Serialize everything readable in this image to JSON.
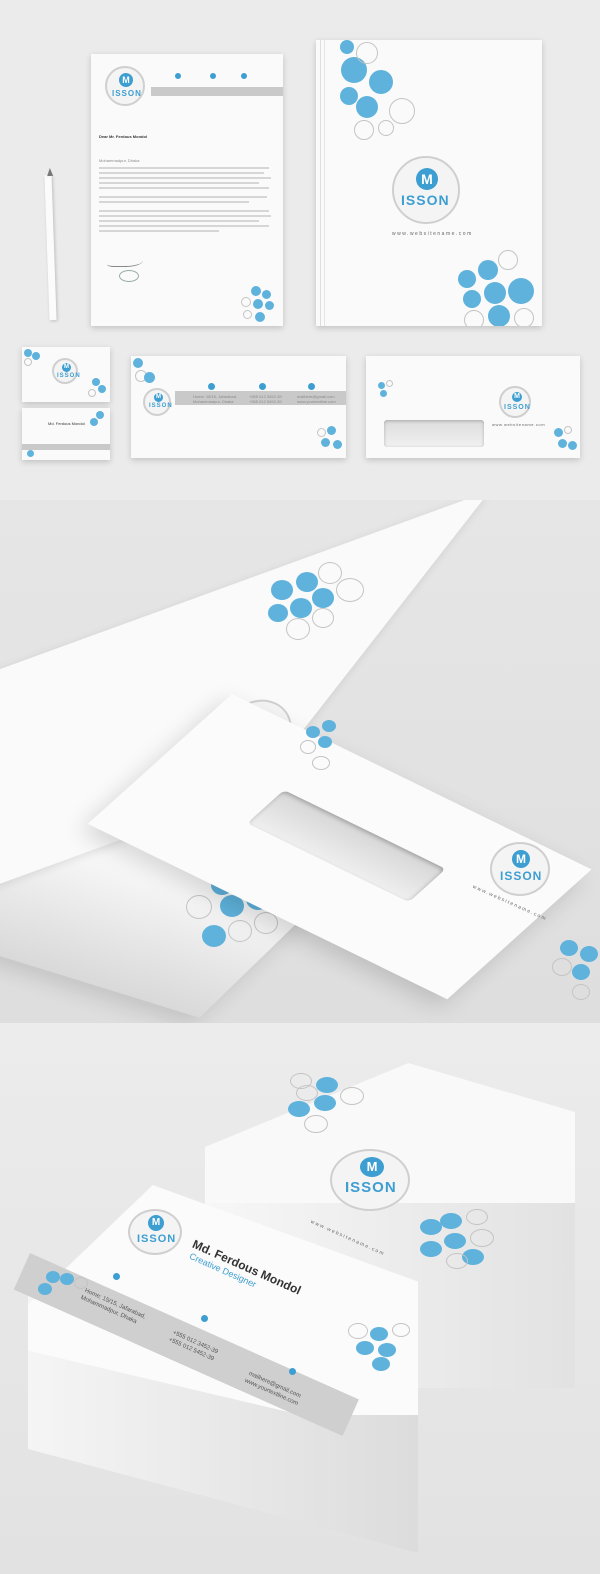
{
  "brand": {
    "logo_letter": "M",
    "logo_name": "ISSON",
    "website": "www.websitename.com",
    "accent_color": "#3d9ed1",
    "circle_color": "#5fb2dc"
  },
  "letterhead": {
    "recipient_name": "Dear Mr. Ferdous Mondol",
    "address_line": "Mohammadpur, Dhaka"
  },
  "contact": {
    "address1": "Home: 15/15, Jafarabad,",
    "address2": "Mohammadpur, Dhaka",
    "phone1": "+555 012 3452-39",
    "phone2": "+555 012 5452-39",
    "email": "mailhere@gmail.com",
    "site": "www.yourtextline.com"
  },
  "business_card": {
    "name": "Md. Ferdous Mondol",
    "title": "Creative Designer"
  },
  "icons": [
    "location-pin-icon",
    "phone-icon",
    "email-icon"
  ]
}
